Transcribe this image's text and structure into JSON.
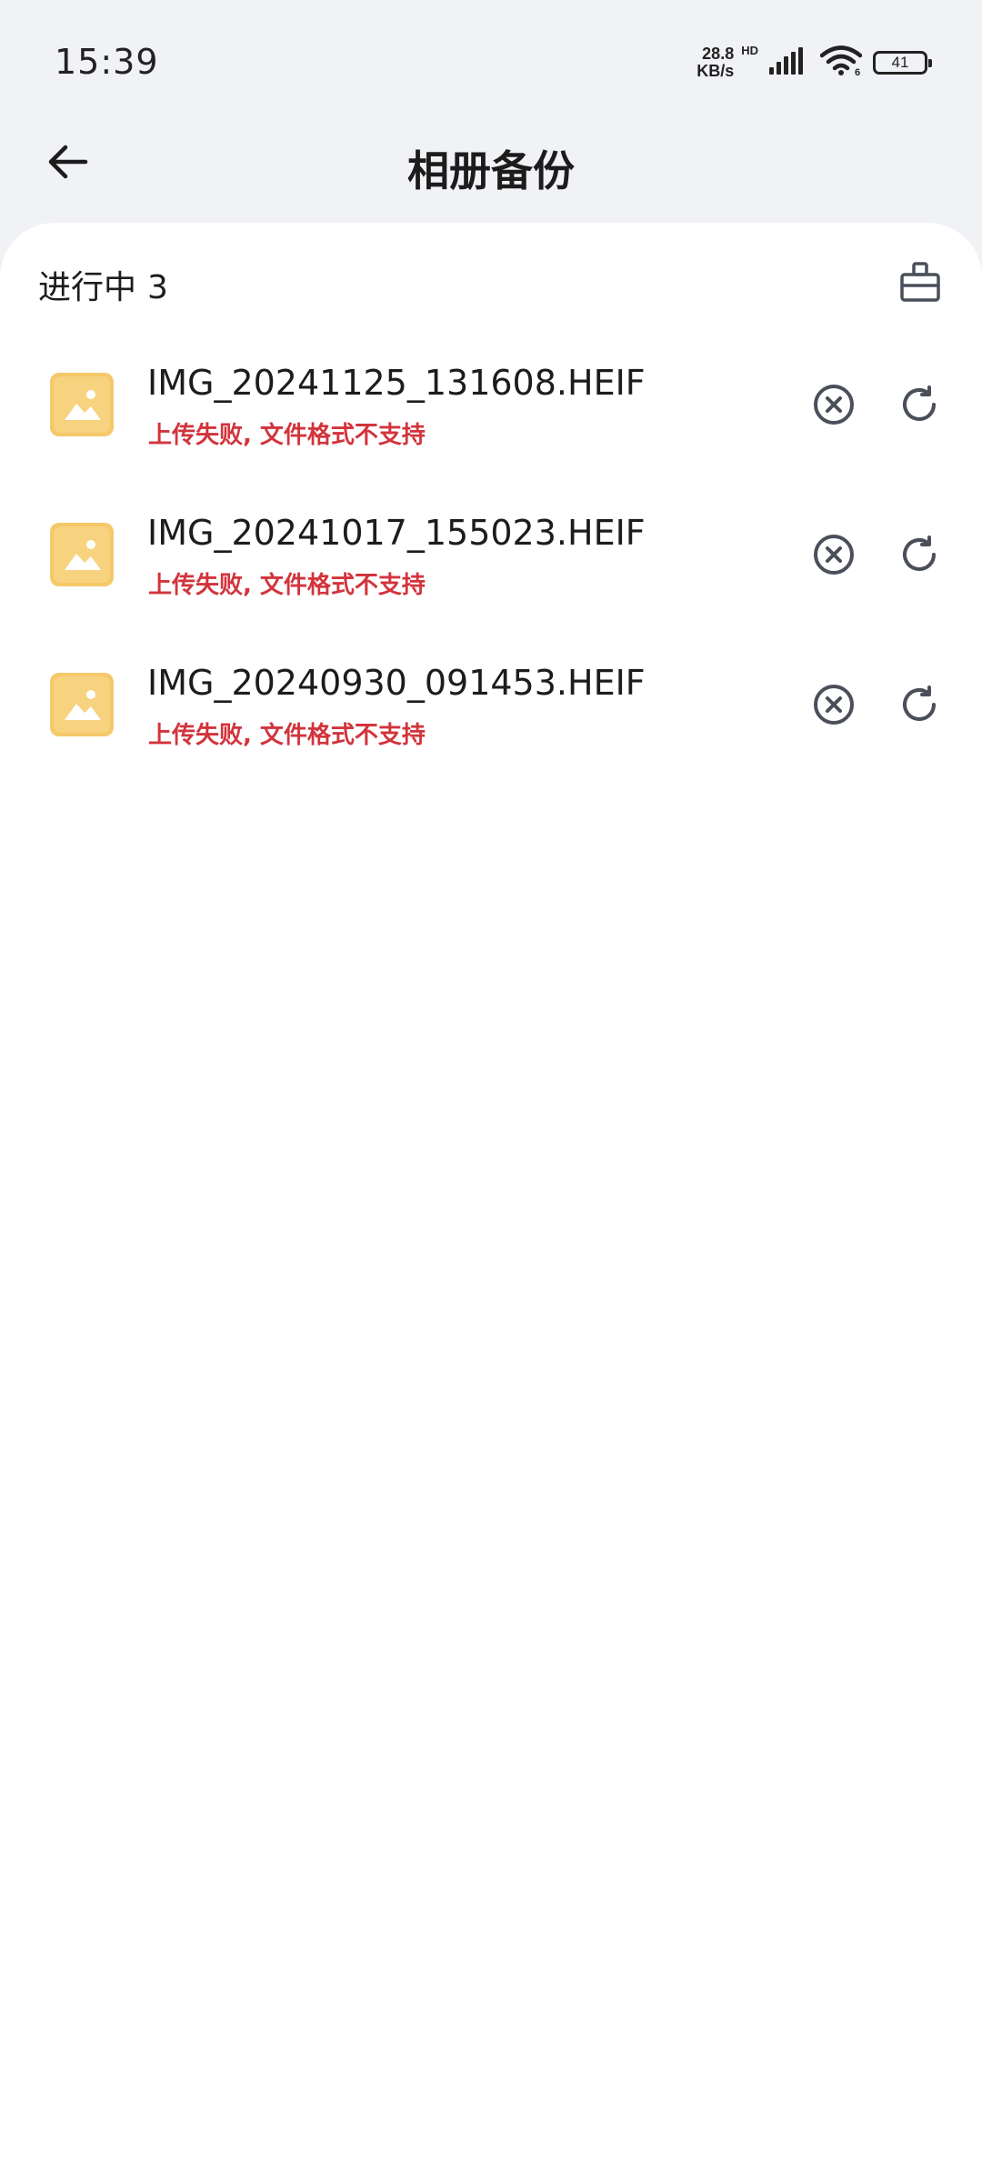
{
  "status_bar": {
    "time": "15:39",
    "net_speed_value": "28.8",
    "net_speed_unit": "KB/s",
    "hd_label": "HD",
    "battery_level": "41",
    "icons": [
      "signal-icon",
      "wifi-icon",
      "battery-icon"
    ]
  },
  "header": {
    "title": "相册备份",
    "back_icon": "arrow-left-icon"
  },
  "section": {
    "label": "进行中",
    "count": "3",
    "clear_icon": "broom-icon"
  },
  "items": [
    {
      "file_name": "IMG_20241125_131608.HEIF",
      "status": "上传失败, 文件格式不支持",
      "thumb_icon": "image-icon"
    },
    {
      "file_name": "IMG_20241017_155023.HEIF",
      "status": "上传失败, 文件格式不支持",
      "thumb_icon": "image-icon"
    },
    {
      "file_name": "IMG_20240930_091453.HEIF",
      "status": "上传失败, 文件格式不支持",
      "thumb_icon": "image-icon"
    }
  ],
  "colors": {
    "background": "#f1f2f6",
    "card": "#ffffff",
    "error_text": "#d2343c",
    "thumb_yellow": "#f5c86a",
    "icon_gray": "#4a4f5a"
  }
}
